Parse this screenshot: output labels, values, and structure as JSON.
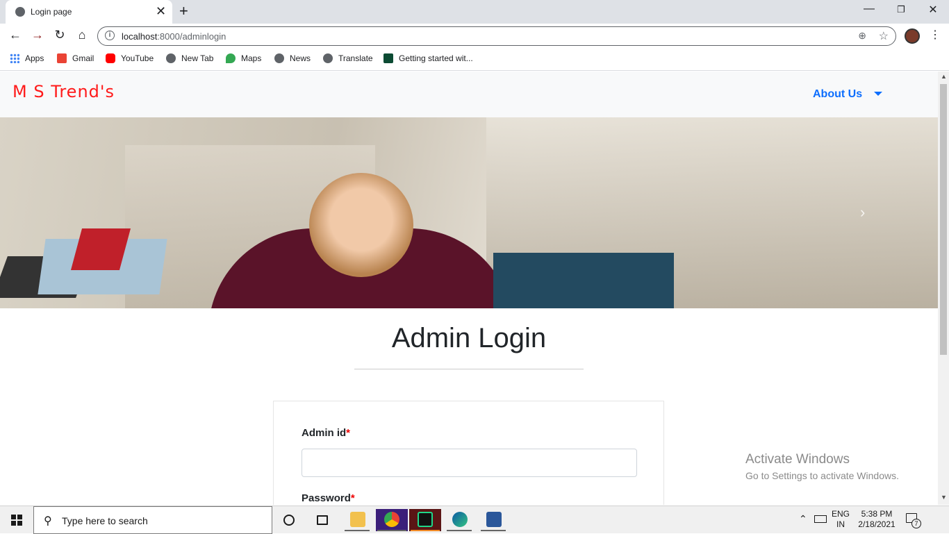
{
  "browser": {
    "tab_title": "Login page",
    "tab_close": "✕",
    "new_tab": "+",
    "url_host": "localhost",
    "url_path": ":8000/adminlogin",
    "window_controls": {
      "minimize": "—",
      "restore": "❐",
      "close": "✕"
    }
  },
  "bookmarks": [
    {
      "label": "Apps",
      "color": "#4285f4"
    },
    {
      "label": "Gmail",
      "color": "#ea4335"
    },
    {
      "label": "YouTube",
      "color": "#ff0000"
    },
    {
      "label": "New Tab",
      "color": "#5f6368"
    },
    {
      "label": "Maps",
      "color": "#34a853"
    },
    {
      "label": "News",
      "color": "#5f6368"
    },
    {
      "label": "Translate",
      "color": "#5f6368"
    },
    {
      "label": "Getting started wit...",
      "color": "#0c4b33"
    }
  ],
  "navbar": {
    "brand": "M S Trend's",
    "about": "About Us",
    "brand_color": "#ff1a1a",
    "link_color": "#0d6efd"
  },
  "hero": {
    "next_arrow": "›"
  },
  "main": {
    "heading": "Admin Login",
    "admin_id_label": "Admin id",
    "password_label": "Password",
    "required_mark": "*",
    "admin_id_value": "",
    "password_value": ""
  },
  "watermark": {
    "title": "Activate Windows",
    "subtitle": "Go to Settings to activate Windows."
  },
  "taskbar": {
    "search_placeholder": "Type here to search",
    "lang_top": "ENG",
    "lang_bottom": "IN",
    "time": "5:38 PM",
    "date": "2/18/2021",
    "notifications": "7"
  }
}
